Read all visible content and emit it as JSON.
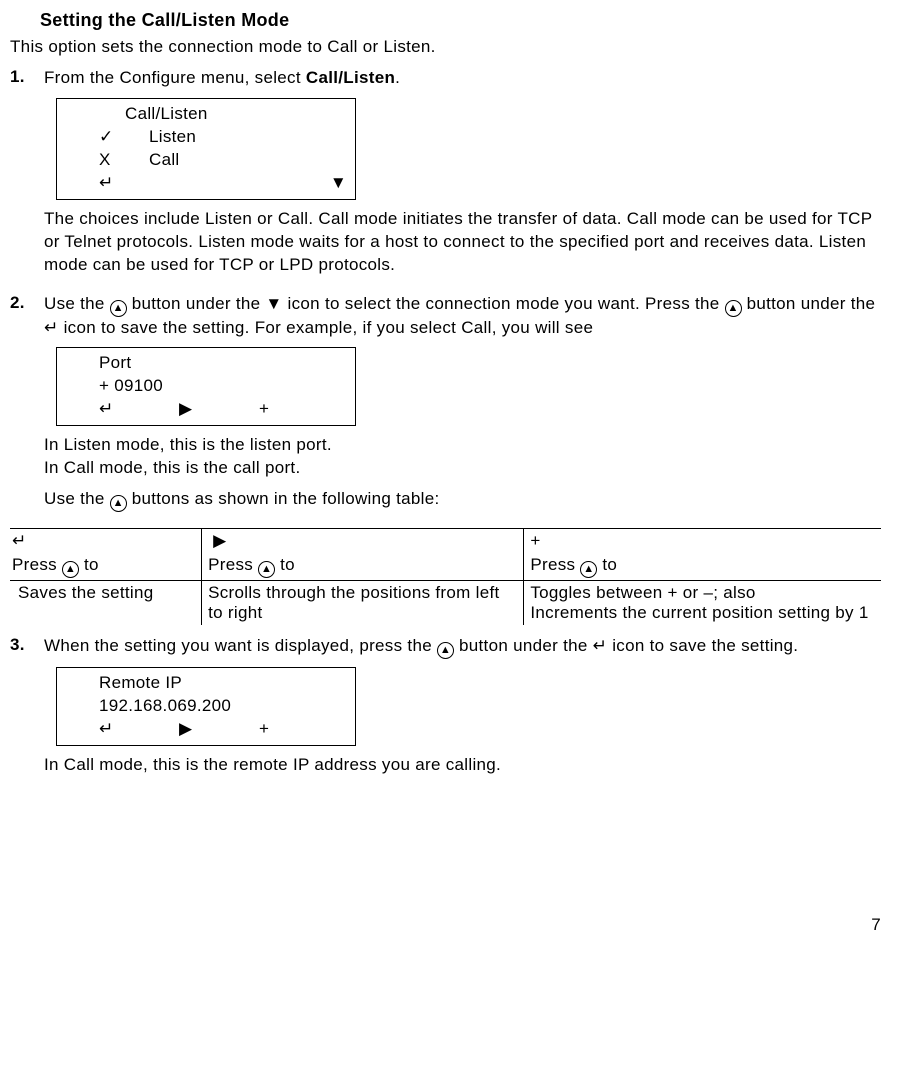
{
  "heading": "Setting the Call/Listen Mode",
  "intro": "This option sets the connection mode to Call or Listen.",
  "step1": {
    "num": "1.",
    "text_pre": "From the Configure menu, select ",
    "menuitem": "Call/Listen",
    "text_post": ".",
    "lcd": {
      "title": "Call/Listen",
      "row1_mark": "✓",
      "row1_label": "Listen",
      "row2_mark": "X",
      "row2_label": "Call",
      "icon_enter": "↵",
      "icon_down": "▼"
    },
    "explain": "The choices include Listen or Call.  Call mode initiates the transfer of data.  Call mode can be used for TCP or Telnet protocols.  Listen mode waits for a host to connect to the specified port and receives data.  Listen mode can be used for TCP or LPD protocols."
  },
  "step2": {
    "num": "2.",
    "seg1": "Use the ",
    "circ": "▲",
    "seg2": " button under the ",
    "down": "▼",
    "seg3": " icon to select the connection mode you want.  Press the ",
    "seg4": " button under the ",
    "enter": "↵",
    "seg5": " icon to save the setting.  For example, if you select Call, you will see",
    "lcd": {
      "title": "Port",
      "value": "+ 09100",
      "icon_enter": "↵",
      "icon_right": "▶",
      "icon_plus": "+"
    },
    "after1": "In Listen mode, this is the listen port.",
    "after2": "In Call mode, this is the call port.",
    "tableintro_pre": "Use the ",
    "tableintro_post": " buttons as shown in the following table:",
    "table": {
      "h1_icon": "↵",
      "h2_icon": "▶",
      "h3_icon": "+",
      "press_to": "Press ",
      "to": " to",
      "c1": "Saves the setting",
      "c2": "Scrolls through the positions from left to right",
      "c3": "Toggles between + or –; also\nIncrements the current position setting by 1"
    }
  },
  "step3": {
    "num": "3.",
    "seg1": "When the setting you want is displayed, press the ",
    "seg2": " button under the ",
    "enter": "↵",
    "seg3": " icon to save the setting.",
    "lcd": {
      "title": "Remote IP",
      "value": "192.168.069.200",
      "icon_enter": "↵",
      "icon_right": "▶",
      "icon_plus": "+"
    },
    "after": "In Call mode, this is the remote IP address you are calling."
  },
  "pagenum": "7"
}
